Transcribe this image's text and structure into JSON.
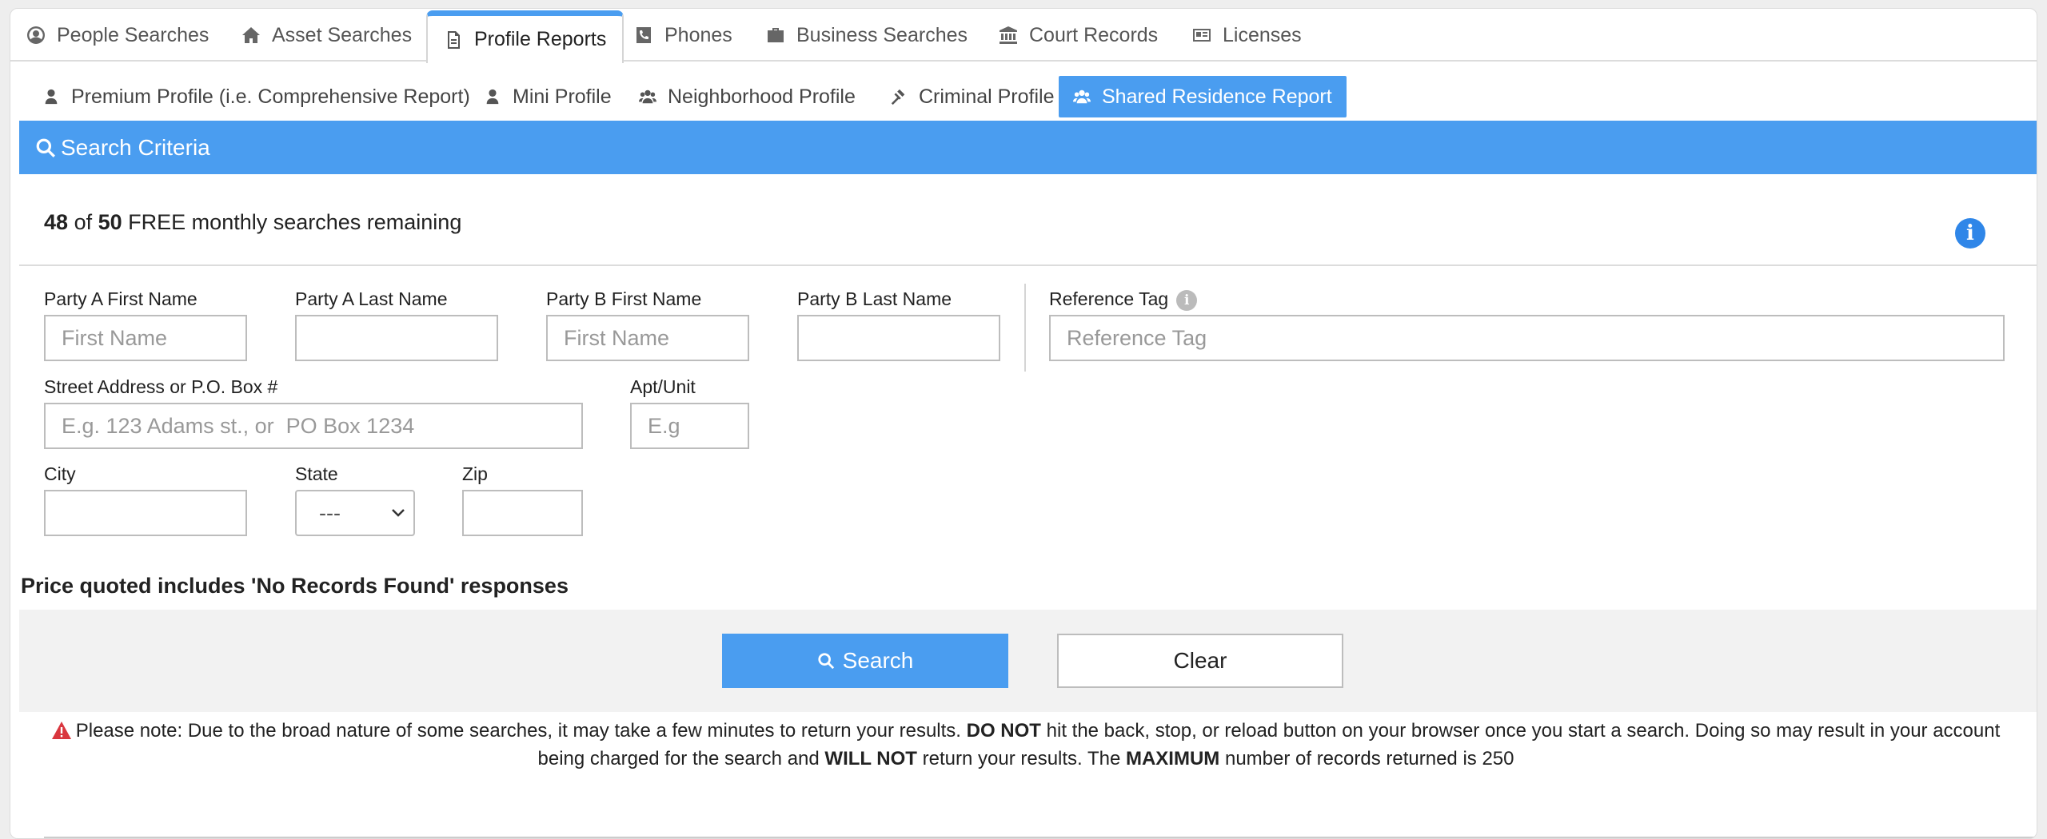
{
  "main_tabs": [
    {
      "label": "People Searches",
      "icon": "user-circle-icon"
    },
    {
      "label": "Asset Searches",
      "icon": "home-icon"
    },
    {
      "label": "Profile Reports",
      "icon": "document-icon",
      "active": true
    },
    {
      "label": "Phones",
      "icon": "phone-icon"
    },
    {
      "label": "Business Searches",
      "icon": "briefcase-icon"
    },
    {
      "label": "Court Records",
      "icon": "courthouse-icon"
    },
    {
      "label": "Licenses",
      "icon": "id-card-icon"
    }
  ],
  "sub_tabs": [
    {
      "label": "Premium Profile (i.e. Comprehensive Report)",
      "icon": "user-icon"
    },
    {
      "label": "Mini Profile",
      "icon": "user-icon"
    },
    {
      "label": "Neighborhood Profile",
      "icon": "users-icon"
    },
    {
      "label": "Criminal Profile",
      "icon": "gavel-icon"
    },
    {
      "label": "Shared Residence Report",
      "icon": "users-icon",
      "active": true
    }
  ],
  "criteria": {
    "title": "Search Criteria"
  },
  "remaining": {
    "used": "48",
    "of": "of",
    "total": "50",
    "text": "FREE monthly searches remaining"
  },
  "form": {
    "party_a_first": {
      "label": "Party A First Name",
      "placeholder": "First Name",
      "value": ""
    },
    "party_a_last": {
      "label": "Party A Last Name",
      "placeholder": "",
      "value": ""
    },
    "party_b_first": {
      "label": "Party B First Name",
      "placeholder": "First Name",
      "value": ""
    },
    "party_b_last": {
      "label": "Party B Last Name",
      "placeholder": "",
      "value": ""
    },
    "reference_tag": {
      "label": "Reference Tag",
      "placeholder": "Reference Tag",
      "value": ""
    },
    "street": {
      "label": "Street Address or P.O. Box #",
      "placeholder": "E.g. 123 Adams st., or  PO Box 1234",
      "value": ""
    },
    "apt": {
      "label": "Apt/Unit",
      "placeholder": "E.g",
      "value": ""
    },
    "city": {
      "label": "City",
      "placeholder": "",
      "value": ""
    },
    "state": {
      "label": "State",
      "selected": "---"
    },
    "zip": {
      "label": "Zip",
      "placeholder": "",
      "value": ""
    }
  },
  "price_note": "Price quoted includes 'No Records Found' responses",
  "buttons": {
    "search": "Search",
    "clear": "Clear"
  },
  "warning": {
    "p1": "Please note: Due to the broad nature of some searches, it may take a few minutes to return your results. ",
    "b1": "DO NOT",
    "p2": " hit the back, stop, or reload button on your browser once you start a search. Doing so may result in your account being charged for the search and ",
    "b2": "WILL NOT",
    "p3": " return your results. The ",
    "b3": "MAXIMUM",
    "p4": " number of records returned is 250"
  },
  "colors": {
    "accent": "#4a9df0",
    "info": "#2f86e8",
    "warning": "#d9363e"
  }
}
